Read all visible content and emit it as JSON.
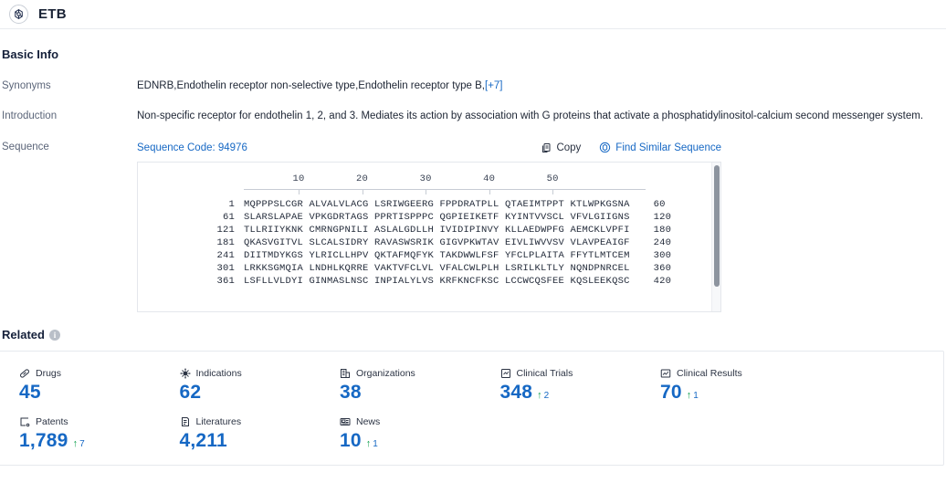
{
  "header": {
    "icon": "target-crosshair-icon",
    "title": "ETB"
  },
  "basic_info": {
    "section_title": "Basic Info",
    "rows": {
      "synonyms": {
        "label": "Synonyms",
        "value": "EDNRB,Endothelin receptor non-selective type,Endothelin receptor type B,",
        "more_link": "[+7]"
      },
      "introduction": {
        "label": "Introduction",
        "value": "Non-specific receptor for endothelin 1, 2, and 3. Mediates its action by association with G proteins that activate a phosphatidylinositol-calcium second messenger system."
      },
      "sequence": {
        "label": "Sequence",
        "code_label": "Sequence Code: 94976",
        "copy_label": "Copy",
        "copy_icon": "copy-icon",
        "similar_label": "Find Similar Sequence",
        "similar_icon": "find-similar-sequence-icon"
      }
    }
  },
  "sequence_viewer": {
    "ruler": [
      10,
      20,
      30,
      40,
      50
    ],
    "rows": [
      {
        "start": "1",
        "blocks": "MQPPPSLCGR ALVALVLACG LSRIWGEERG FPPDRATPLL QTAEIMTPPT KTLWPKGSNA",
        "end": "60"
      },
      {
        "start": "61",
        "blocks": "SLARSLAPAE VPKGDRTAGS PPRTISPPPC QGPIEIKETF KYINTVVSCL VFVLGIIGNS",
        "end": "120"
      },
      {
        "start": "121",
        "blocks": "TLLRIIYKNK CMRNGPNILI ASLALGDLLH IVIDIPINVY KLLAEDWPFG AEMCKLVPFI",
        "end": "180"
      },
      {
        "start": "181",
        "blocks": "QKASVGITVL SLCALSIDRY RAVASWSRIK GIGVPKWTAV EIVLIWVVSV VLAVPEAIGF",
        "end": "240"
      },
      {
        "start": "241",
        "blocks": "DIITMDYKGS YLRICLLHPV QKTAFMQFYK TAKDWWLFSF YFCLPLAITA FFYTLMTCEM",
        "end": "300"
      },
      {
        "start": "301",
        "blocks": "LRKKSGMQIA LNDHLKQRRE VAKTVFCLVL VFALCWLPLH LSRILKLTLY NQNDPNRCEL",
        "end": "360"
      },
      {
        "start": "361",
        "blocks": "LSFLLVLDYI GINMASLNSC INPIALYLVS KRFKNCFKSC LCCWCQSFEE KQSLEEKQSC",
        "end": "420"
      }
    ]
  },
  "related": {
    "section_title": "Related",
    "info_icon": "info-icon",
    "cards": [
      {
        "label": "Drugs",
        "icon": "pill-icon",
        "value": "45",
        "delta": ""
      },
      {
        "label": "Indications",
        "icon": "virus-icon",
        "value": "62",
        "delta": ""
      },
      {
        "label": "Organizations",
        "icon": "organization-icon",
        "value": "38",
        "delta": ""
      },
      {
        "label": "Clinical Trials",
        "icon": "clinical-trial-icon",
        "value": "348",
        "delta": "2"
      },
      {
        "label": "Clinical Results",
        "icon": "clinical-result-icon",
        "value": "70",
        "delta": "1"
      },
      {
        "label": "Patents",
        "icon": "patent-icon",
        "value": "1,789",
        "delta": "7"
      },
      {
        "label": "Literatures",
        "icon": "literature-icon",
        "value": "4,211",
        "delta": ""
      },
      {
        "label": "News",
        "icon": "news-icon",
        "value": "10",
        "delta": "1"
      }
    ],
    "delta_arrow": "↑"
  },
  "colors": {
    "accent_blue": "#1668c4",
    "delta_green": "#12a150",
    "label_gray": "#5b6579",
    "border": "#e6e9ee"
  }
}
